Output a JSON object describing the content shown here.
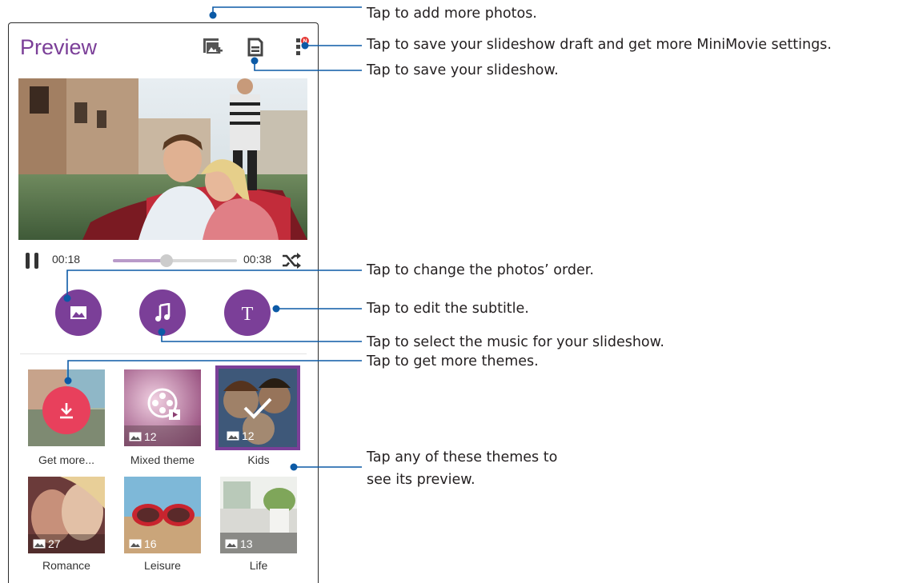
{
  "header": {
    "title": "Preview"
  },
  "player": {
    "elapsed": "00:18",
    "total": "00:38",
    "progress": 0.43
  },
  "themes": [
    {
      "label": "Get more...",
      "count": ""
    },
    {
      "label": "Mixed theme",
      "count": "12"
    },
    {
      "label": "Kids",
      "count": "12",
      "selected": true
    },
    {
      "label": "Romance",
      "count": "27"
    },
    {
      "label": "Leisure",
      "count": "16"
    },
    {
      "label": "Life",
      "count": "13"
    }
  ],
  "callouts": {
    "add_photos": "Tap to add more photos.",
    "save_draft": "Tap to save your slideshow draft and get more MiniMovie settings.",
    "save": "Tap to save your slideshow.",
    "order": "Tap to change the photos’ order.",
    "subtitle": "Tap to edit the subtitle.",
    "music": "Tap to select the music for your slideshow.",
    "more_themes": "Tap to get more themes.",
    "themes_preview_1": "Tap any of these themes to",
    "themes_preview_2": "see its preview."
  },
  "colors": {
    "accent": "#7b3f98",
    "download": "#e8405c",
    "callout_line": "#0c5aa6",
    "badge": "#e53935"
  },
  "icons": [
    "add-photo-icon",
    "save-icon",
    "more-settings-icon",
    "pause-icon",
    "shuffle-icon",
    "photos-order-icon",
    "music-icon",
    "subtitle-icon",
    "download-icon",
    "film-reel-icon",
    "checkmark-icon",
    "image-count-icon"
  ]
}
